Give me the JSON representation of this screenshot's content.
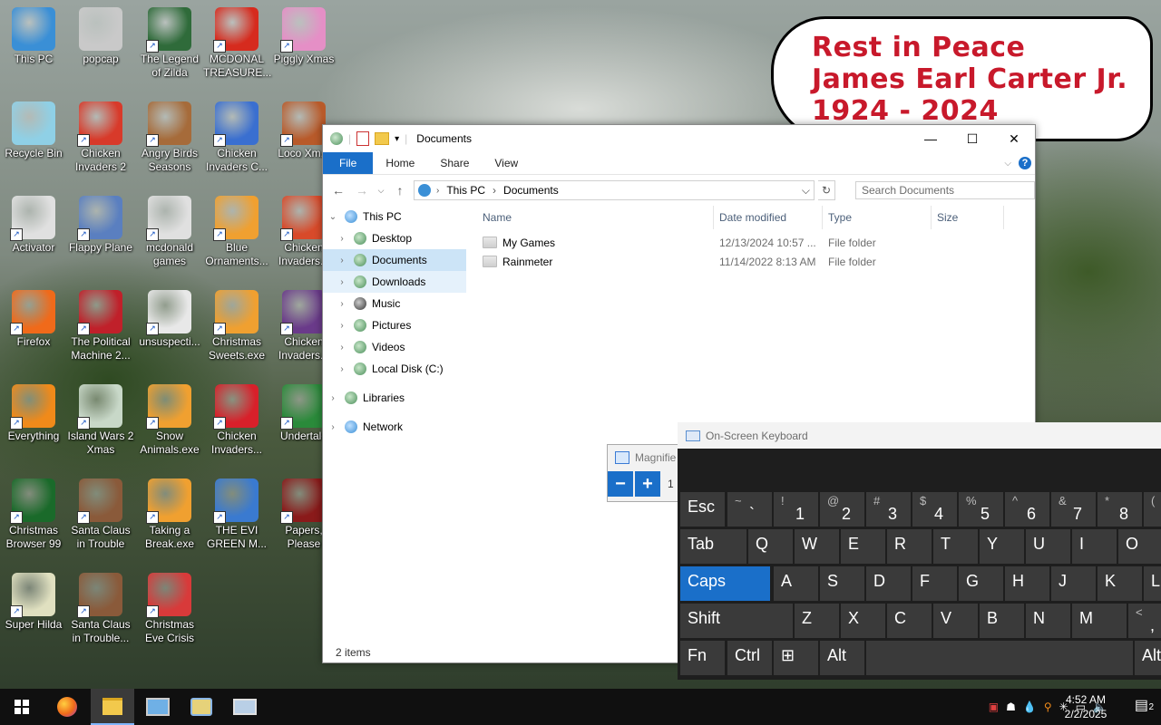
{
  "desktop": {
    "icons": [
      {
        "label": "This PC",
        "color": "#3a8fd6"
      },
      {
        "label": "popcap",
        "color": "#c9c9c9"
      },
      {
        "label": "The Legend of Zilda",
        "color": "#2f6b3a"
      },
      {
        "label": "MCDONAL TREASURE...",
        "color": "#d62b1e"
      },
      {
        "label": "Piggly Xmas",
        "color": "#e58fc6"
      },
      {
        "label": "Recycle Bin",
        "color": "#8fd0e6"
      },
      {
        "label": "Chicken Invaders 2",
        "color": "#d83a2a"
      },
      {
        "label": "Angry Birds Seasons",
        "color": "#a66b3a"
      },
      {
        "label": "Chicken Invaders C...",
        "color": "#3a6fd0"
      },
      {
        "label": "Loco Xm...",
        "color": "#b85a2a"
      },
      {
        "label": "Activator",
        "color": "#e0e0e0"
      },
      {
        "label": "Flappy Plane",
        "color": "#5a7fc0"
      },
      {
        "label": "mcdonald games",
        "color": "#e0e0e0"
      },
      {
        "label": "Blue Ornaments...",
        "color": "#f0a030"
      },
      {
        "label": "Chicken Invaders...",
        "color": "#d84a2a"
      },
      {
        "label": "Firefox",
        "color": "#f06a1a"
      },
      {
        "label": "The Political Machine 2...",
        "color": "#c0202a"
      },
      {
        "label": "unsuspecti...",
        "color": "#e8e8e8"
      },
      {
        "label": "Christmas Sweets.exe",
        "color": "#f0a030"
      },
      {
        "label": "Chicken Invaders...",
        "color": "#6a3a8a"
      },
      {
        "label": "Everything",
        "color": "#f08a1a"
      },
      {
        "label": "Island Wars 2 Xmas",
        "color": "#c8d8c8"
      },
      {
        "label": "Snow Animals.exe",
        "color": "#f0a030"
      },
      {
        "label": "Chicken Invaders...",
        "color": "#d8202a"
      },
      {
        "label": "Undertale",
        "color": "#2a8a3a"
      },
      {
        "label": "Christmas Browser 99",
        "color": "#1a6a2a"
      },
      {
        "label": "Santa Claus in Trouble",
        "color": "#8a5a3a"
      },
      {
        "label": "Taking a Break.exe",
        "color": "#f0a030"
      },
      {
        "label": "THE EVI GREEN M...",
        "color": "#3a7ad0"
      },
      {
        "label": "Papers, Please",
        "color": "#8a1a1a"
      },
      {
        "label": "Super Hilda",
        "color": "#e0e0c0"
      },
      {
        "label": "Santa Claus in Trouble...",
        "color": "#8a5a3a"
      },
      {
        "label": "Christmas Eve Crisis",
        "color": "#d83a3a"
      }
    ]
  },
  "sign": {
    "line1": "Rest in Peace",
    "line2": "James Earl Carter Jr.",
    "line3": "1924 - 2024"
  },
  "explorer": {
    "title": "Documents",
    "ribbon_tabs": [
      "File",
      "Home",
      "Share",
      "View"
    ],
    "address": {
      "root": "This PC",
      "current": "Documents"
    },
    "search_placeholder": "Search Documents",
    "nav": [
      {
        "label": "This PC",
        "level": 0,
        "expanded": true
      },
      {
        "label": "Desktop",
        "level": 1
      },
      {
        "label": "Documents",
        "level": 1,
        "selected": true
      },
      {
        "label": "Downloads",
        "level": 1,
        "hover": true
      },
      {
        "label": "Music",
        "level": 1
      },
      {
        "label": "Pictures",
        "level": 1
      },
      {
        "label": "Videos",
        "level": 1
      },
      {
        "label": "Local Disk (C:)",
        "level": 1
      },
      {
        "label": "Libraries",
        "level": 0
      },
      {
        "label": "Network",
        "level": 0
      }
    ],
    "columns": [
      "Name",
      "Date modified",
      "Type",
      "Size"
    ],
    "rows": [
      {
        "name": "My Games",
        "date": "12/13/2024 10:57 ...",
        "type": "File folder",
        "size": ""
      },
      {
        "name": "Rainmeter",
        "date": "11/14/2022 8:13 AM",
        "type": "File folder",
        "size": ""
      }
    ],
    "status": "2 items"
  },
  "magnifier": {
    "title": "Magnifie",
    "zoom_partial": "1"
  },
  "osk": {
    "title": "On-Screen Keyboard",
    "rows": [
      [
        {
          "t": "Esc"
        },
        {
          "s": "~",
          "l": "`"
        },
        {
          "s": "!",
          "l": "1"
        },
        {
          "s": "@",
          "l": "2"
        },
        {
          "s": "#",
          "l": "3"
        },
        {
          "s": "$",
          "l": "4"
        },
        {
          "s": "%",
          "l": "5"
        },
        {
          "s": "^",
          "l": "6"
        },
        {
          "s": "&",
          "l": "7"
        },
        {
          "s": "*",
          "l": "8"
        },
        {
          "s": "(",
          "l": ""
        }
      ],
      [
        {
          "t": "Tab"
        },
        {
          "t": "Q"
        },
        {
          "t": "W"
        },
        {
          "t": "E"
        },
        {
          "t": "R"
        },
        {
          "t": "T"
        },
        {
          "t": "Y"
        },
        {
          "t": "U"
        },
        {
          "t": "I"
        },
        {
          "t": "O"
        }
      ],
      [
        {
          "t": "Caps"
        },
        {
          "t": "A"
        },
        {
          "t": "S"
        },
        {
          "t": "D"
        },
        {
          "t": "F"
        },
        {
          "t": "G"
        },
        {
          "t": "H"
        },
        {
          "t": "J"
        },
        {
          "t": "K"
        },
        {
          "t": "L"
        }
      ],
      [
        {
          "t": "Shift"
        },
        {
          "t": "Z"
        },
        {
          "t": "X"
        },
        {
          "t": "C"
        },
        {
          "t": "V"
        },
        {
          "t": "B"
        },
        {
          "t": "N"
        },
        {
          "t": "M"
        },
        {
          "s": "<",
          "l": ","
        }
      ],
      [
        {
          "t": "Fn"
        },
        {
          "t": "Ctrl"
        },
        {
          "t": "⊞"
        },
        {
          "t": "Alt"
        },
        {
          "t": ""
        },
        {
          "t": "Alt"
        }
      ]
    ]
  },
  "taskbar": {
    "time": "4:52 AM",
    "date": "2/2/2025",
    "notifications": "2"
  }
}
